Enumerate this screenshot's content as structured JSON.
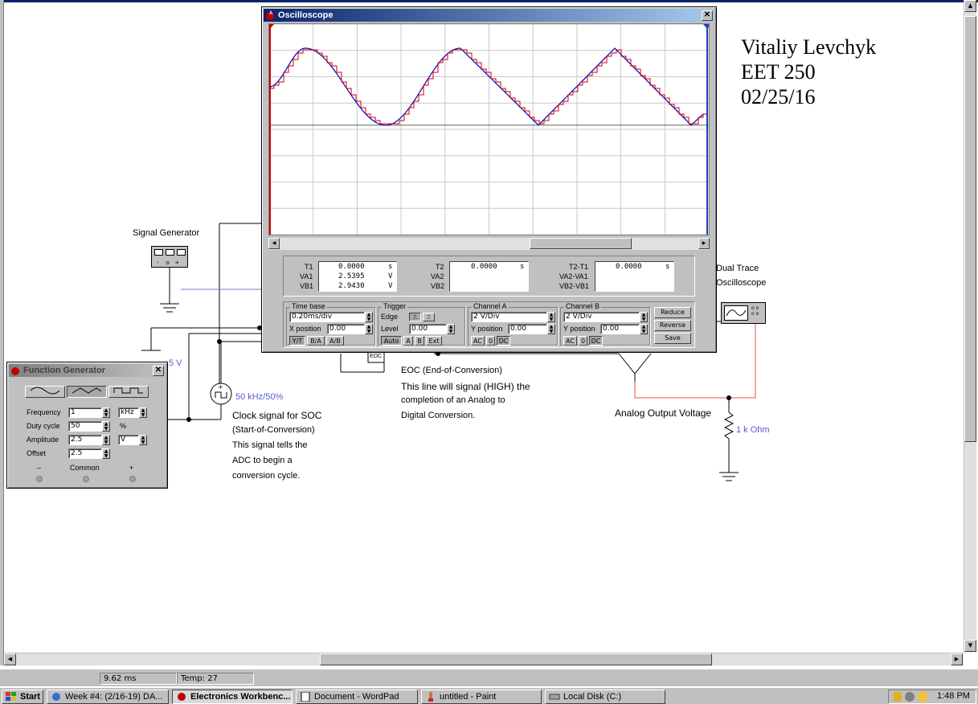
{
  "oscilloscope": {
    "title": "Oscilloscope",
    "readouts": {
      "t1_label": "T1",
      "t1_value": "0.0000",
      "t1_unit": "s",
      "va1_label": "VA1",
      "va1_value": "2.5395",
      "va1_unit": "V",
      "vb1_label": "VB1",
      "vb1_value": "2.9430",
      "vb1_unit": "V",
      "t2_label": "T2",
      "t2_value": "0.0000",
      "t2_unit": "s",
      "va2_label": "VA2",
      "vb2_label": "VB2",
      "dt_label": "T2-T1",
      "dt_value": "0.0000",
      "dt_unit": "s",
      "dva_label": "VA2-VA1",
      "dvb_label": "VB2-VB1"
    },
    "timebase": {
      "title": "Time base",
      "value": "0.20ms/div",
      "xpos_label": "X position",
      "xpos_value": "0.00",
      "btn_yt": "Y/T",
      "btn_ba": "B/A",
      "btn_ab": "A/B"
    },
    "trigger": {
      "title": "Trigger",
      "edge_label": "Edge",
      "level_label": "Level",
      "level_value": "0.00",
      "btn_auto": "Auto",
      "btn_a": "A",
      "btn_b": "B",
      "btn_ext": "Ext"
    },
    "channel_a": {
      "title": "Channel A",
      "value": "2 V/Div",
      "ypos_label": "Y position",
      "ypos_value": "0.00",
      "btn_ac": "AC",
      "btn_0": "0",
      "btn_dc": "DC"
    },
    "channel_b": {
      "title": "Channel B",
      "value": "2 V/Div",
      "ypos_label": "Y position",
      "ypos_value": "0.00",
      "btn_ac": "AC",
      "btn_0": "0",
      "btn_dc": "DC"
    },
    "buttons": {
      "reduce": "Reduce",
      "reverse": "Reverse",
      "save": "Save"
    },
    "colors": {
      "grid": "#c8c8c8",
      "trace_a": "#0000cc",
      "trace_b": "#d00000",
      "screen": "#ffffff"
    }
  },
  "function_generator": {
    "title": "Function Generator",
    "frequency_label": "Frequency",
    "frequency_value": "1",
    "frequency_unit": "kHz",
    "duty_label": "Duty cycle",
    "duty_value": "50",
    "duty_unit": "%",
    "amplitude_label": "Amplitude",
    "amplitude_value": "2.5",
    "amplitude_unit": "V",
    "offset_label": "Offset",
    "offset_value": "2.5",
    "terminal_minus": "–",
    "terminal_common": "Common",
    "terminal_plus": "+"
  },
  "schematic": {
    "signal_generator_label": "Signal Generator",
    "dual_trace_label_1": "Dual Trace",
    "dual_trace_label_2": "Oscilloscope",
    "clock_value": "50 kHz/50%",
    "clock_note": [
      "Clock signal for SOC",
      "(Start-of-Conversion)",
      "This signal tells the",
      "ADC to begin a",
      "conversion cycle."
    ],
    "eoc_note": [
      "EOC (End-of-Conversion)",
      "This line will signal (HIGH) the",
      "completion of an Analog to",
      "Digital Conversion."
    ],
    "analog_output_label": "Analog Output Voltage",
    "resistor_value": "1 k Ohm",
    "eoc_pin": "EOC",
    "voltage_fragment": "5 V"
  },
  "header_text": {
    "name": "Vitaliy Levchyk",
    "course": "EET 250",
    "date": "02/25/16"
  },
  "status_bar": {
    "time": "9.62 ms",
    "temp": "Temp:  27"
  },
  "taskbar": {
    "start": "Start",
    "items": [
      "Week #4: (2/16-19) DA...",
      "Electronics Workbenc...",
      "Document - WordPad",
      "untitled - Paint",
      "Local Disk (C:)"
    ],
    "clock": "1:48 PM"
  }
}
